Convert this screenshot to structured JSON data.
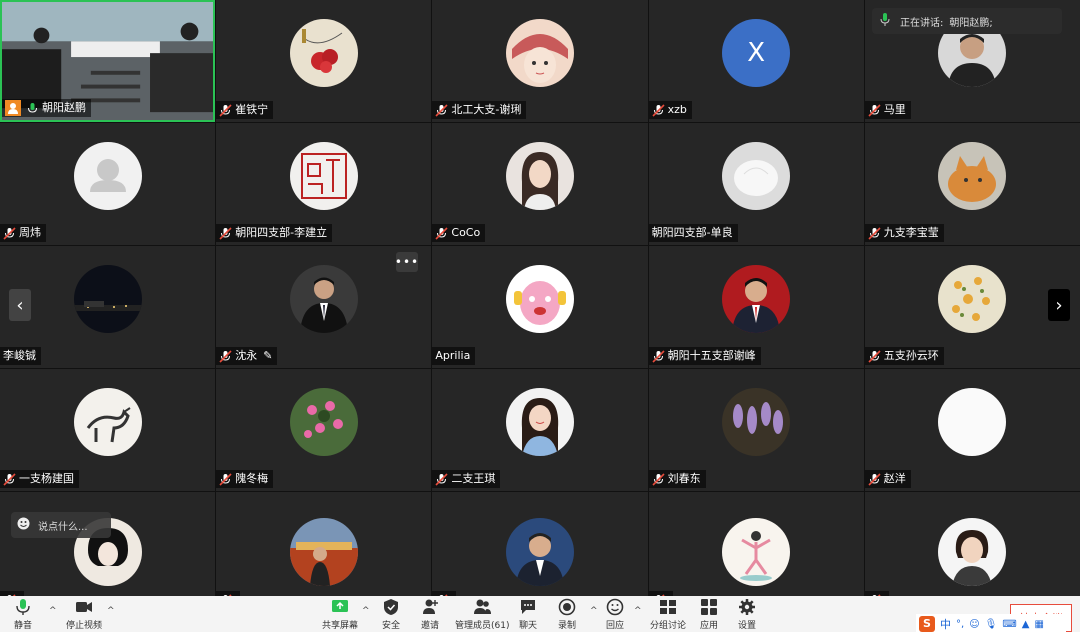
{
  "speaking": {
    "label": "正在讲话:",
    "name": "朝阳赵鹏;"
  },
  "participants": [
    {
      "name": "朝阳赵鹏",
      "kind": "video"
    },
    {
      "name": "崔铁宁",
      "kind": "painting-red"
    },
    {
      "name": "北工大支-谢琍",
      "kind": "cartoon-girl"
    },
    {
      "name": "xzb",
      "kind": "initial",
      "initial": "X"
    },
    {
      "name": "马里",
      "kind": "man-dark"
    },
    {
      "name": "周炜",
      "kind": "default"
    },
    {
      "name": "朝阳四支部-李建立",
      "kind": "seal"
    },
    {
      "name": "CoCo",
      "kind": "woman-light"
    },
    {
      "name": "朝阳四支部-单良",
      "kind": "white-object"
    },
    {
      "name": "九支李宝莹",
      "kind": "cat"
    },
    {
      "name": "李峻铖",
      "kind": "night"
    },
    {
      "name": "沈永",
      "kind": "man-suit-dark"
    },
    {
      "name": "Aprilia",
      "kind": "pink-cartoon"
    },
    {
      "name": "朝阳十五支部谢峰",
      "kind": "man-suit-red"
    },
    {
      "name": "五支孙云环",
      "kind": "flowers-yellow"
    },
    {
      "name": "一支杨建国",
      "kind": "horse-painting"
    },
    {
      "name": "隗冬梅",
      "kind": "flowers-pink"
    },
    {
      "name": "二支王琪",
      "kind": "woman-smile"
    },
    {
      "name": "刘春东",
      "kind": "wisteria"
    },
    {
      "name": "赵洋",
      "kind": "blank-white"
    },
    {
      "name": "",
      "kind": "woman-ink"
    },
    {
      "name": "",
      "kind": "man-temple"
    },
    {
      "name": "",
      "kind": "man-tv"
    },
    {
      "name": "",
      "kind": "yoga"
    },
    {
      "name": "",
      "kind": "woman-short"
    }
  ],
  "chat": {
    "placeholder": "说点什么..."
  },
  "toolbar": {
    "mute": "静音",
    "stop_video": "停止视频",
    "share": "共享屏幕",
    "security": "安全",
    "invite": "邀请",
    "participants": "管理成员(61)",
    "chat": "聊天",
    "record": "录制",
    "reactions": "回应",
    "breakout": "分组讨论",
    "apps": "应用",
    "settings": "设置",
    "end": "结束会议"
  },
  "ime": {
    "lang": "中"
  },
  "colors": {
    "active_border": "#2bc255",
    "end_red": "#e74c3c",
    "initial_bg": "#3b6fc6"
  }
}
